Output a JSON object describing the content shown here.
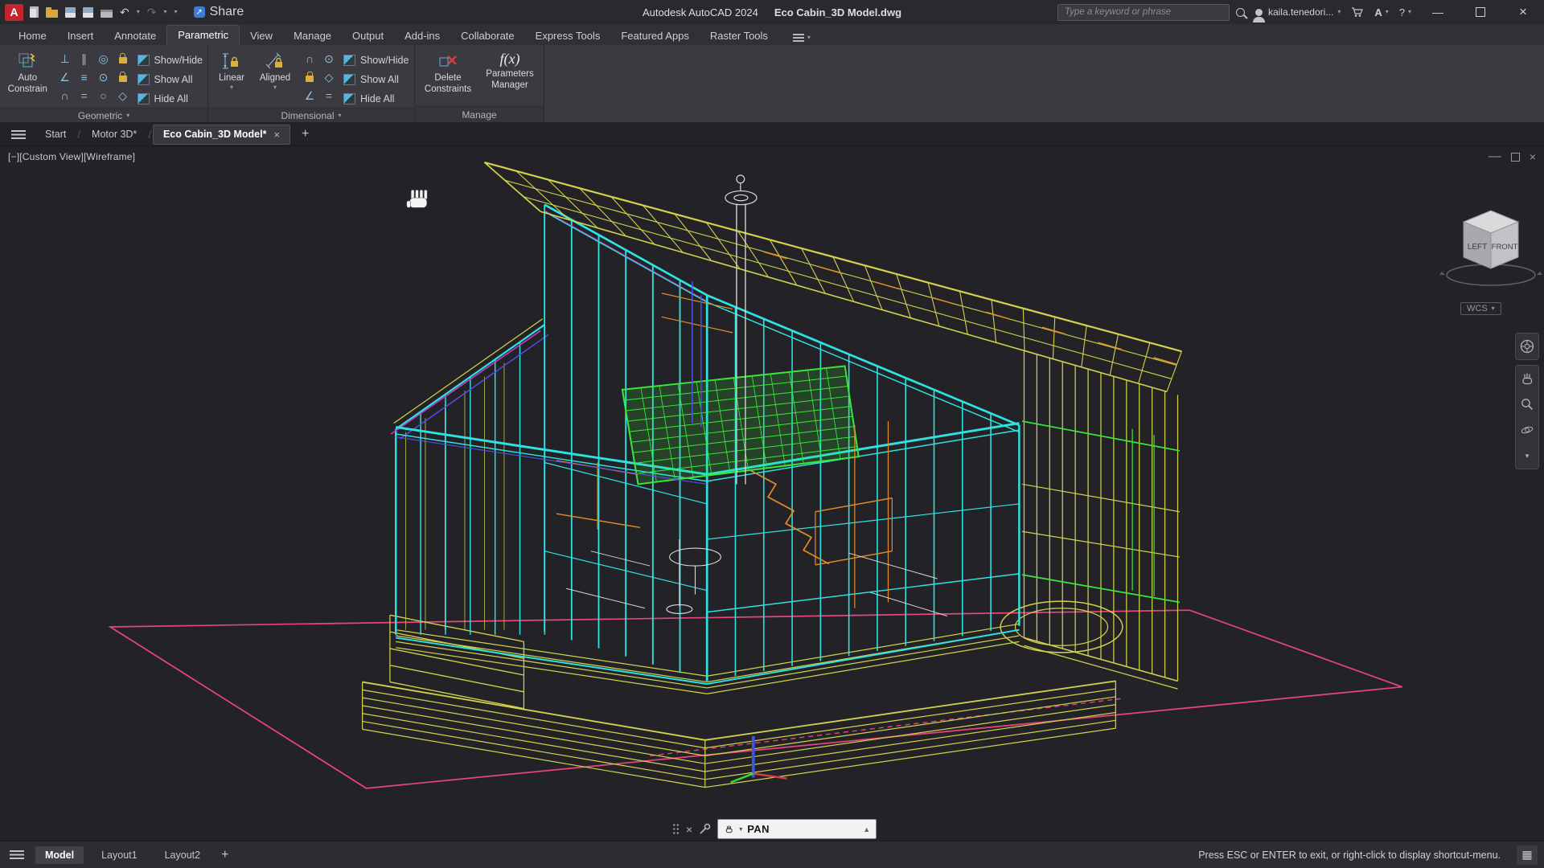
{
  "titlebar": {
    "app_title": "Autodesk AutoCAD 2024",
    "doc_title": "Eco Cabin_3D Model.dwg",
    "share_label": "Share",
    "search_placeholder": "Type a keyword or phrase",
    "user_name": "kaila.tenedori...",
    "help_label": "?"
  },
  "ribbon": {
    "tabs": [
      {
        "label": "Home"
      },
      {
        "label": "Insert"
      },
      {
        "label": "Annotate"
      },
      {
        "label": "Parametric"
      },
      {
        "label": "View"
      },
      {
        "label": "Manage"
      },
      {
        "label": "Output"
      },
      {
        "label": "Add-ins"
      },
      {
        "label": "Collaborate"
      },
      {
        "label": "Express Tools"
      },
      {
        "label": "Featured Apps"
      },
      {
        "label": "Raster Tools"
      }
    ],
    "geometric": {
      "title": "Geometric",
      "auto_line1": "Auto",
      "auto_line2": "Constrain",
      "show_hide": "Show/Hide",
      "show_all": "Show All",
      "hide_all": "Hide All"
    },
    "dimensional": {
      "title": "Dimensional",
      "linear": "Linear",
      "aligned": "Aligned",
      "show_hide": "Show/Hide",
      "show_all": "Show All",
      "hide_all": "Hide All"
    },
    "manage": {
      "title": "Manage",
      "delete_line1": "Delete",
      "delete_line2": "Constraints",
      "fx": "f(x)",
      "params_line1": "Parameters",
      "params_line2": "Manager"
    }
  },
  "doctabs": {
    "tabs": [
      {
        "label": "Start"
      },
      {
        "label": "Motor 3D*"
      },
      {
        "label": "Eco Cabin_3D Model*",
        "active": true
      }
    ]
  },
  "viewport": {
    "corner_label": "[−][Custom View][Wireframe]",
    "viewcube": {
      "left": "LEFT",
      "front": "FRONT"
    },
    "wcs_label": "WCS",
    "command_text": "PAN",
    "colors": {
      "cyan": "#2ee2e2",
      "yellow": "#d2d24e",
      "green": "#3ae83a",
      "orange": "#e08a28",
      "pink": "#e8457d",
      "magenta": "#c83ac8",
      "blue": "#5050e8",
      "white": "#d8d8d8"
    }
  },
  "statusbar": {
    "model": "Model",
    "layout1": "Layout1",
    "layout2": "Layout2",
    "hint": "Press ESC or ENTER to exit, or right-click to display shortcut-menu."
  }
}
